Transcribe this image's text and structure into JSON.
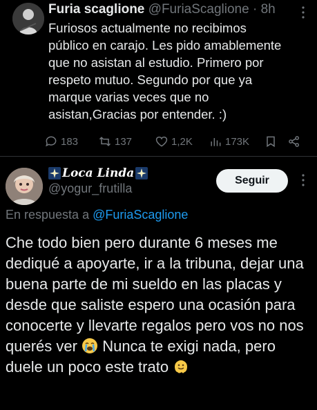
{
  "tweet1": {
    "name": "Furia scaglione",
    "handle": "@FuriaScaglione",
    "separator": "·",
    "time": "8h",
    "text": "Furiosos actualmente no recibimos\npúblico en carajo. Les pido amablemente\nque no asistan al estudio. Primero por\nrespeto mutuo. Segundo por que ya\nmarque varias veces que no\nasistan,Gracias por entender. :)",
    "replies": "183",
    "retweets": "137",
    "likes": "1,2K",
    "views": "173K",
    "icons": [
      "more-icon",
      "reply-icon",
      "retweet-icon",
      "like-icon",
      "views-icon",
      "bookmark-icon",
      "share-icon"
    ]
  },
  "tweet2": {
    "name": "𝑳𝒐𝒄𝒂 𝑳𝒊𝒏𝒅𝒂",
    "handle": "@yogur_frutilla",
    "follow_label": "Seguir",
    "reply_prefix": "En respuesta a",
    "reply_handle": "@FuriaScaglione",
    "text_part1": "Che todo bien pero durante 6 meses me dediqué a apoyarte, ir a la tribuna, dejar una buena parte de mi sueldo en las placas y desde que saliste espero una ocasión para conocerte y llevarte regalos pero vos no nos querés ver",
    "text_part2": "Nunca te exigi nada, pero duele un poco este trato",
    "emojis": [
      "crying-face-emoji",
      "melting-face-emoji",
      "sparkles-emoji"
    ]
  },
  "colors": {
    "background": "#000000",
    "text": "#e7e9ea",
    "secondary": "#71767b",
    "link": "#1d9bf0",
    "divider": "#2f3336",
    "button_bg": "#eff3f4"
  }
}
